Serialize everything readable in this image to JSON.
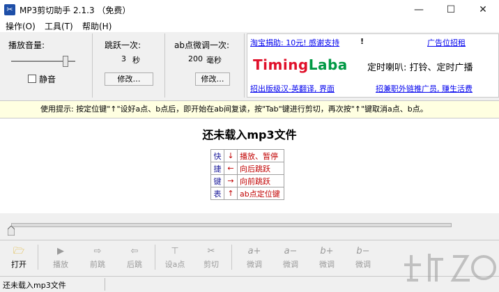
{
  "window": {
    "title": "MP3剪切助手 2.1.3 （免费）",
    "minimize": "—",
    "maximize": "☐",
    "close": "✕"
  },
  "menu": {
    "items": [
      "操作(O)",
      "工具(T)",
      "帮助(H)"
    ]
  },
  "volume_panel": {
    "label": "播放音量:",
    "level": 0.85,
    "mute_label": "静音",
    "mute_checked": false
  },
  "jump_panel": {
    "label": "跳跃一次:",
    "value": "3",
    "unit": "秒",
    "button": "修改…"
  },
  "ab_panel": {
    "label": "ab点微调一次:",
    "value": "200",
    "unit": "毫秒",
    "button": "修改…"
  },
  "ad_panel": {
    "donate_link": "淘宝捐助: 10元! 感谢支持",
    "donate_suffix": "!",
    "ad_link": "广告位招租",
    "logo_text": "TimingLaba",
    "logo_slogan": "定时喇叭: 打铃、定时广播",
    "bottom_left_link": "招出版级汉-英翻译, 界面",
    "bottom_right_link": "招兼职外链推广员, 赚生活费"
  },
  "tip": "使用提示: 按定位键\"↑\"设好a点、b点后，即开始在ab间复读，按\"Tab\"键进行剪切，再次按\"↑\"键取消a点、b点。",
  "main": {
    "title": "还未载入mp3文件",
    "shortcut_chars": [
      "快",
      "捷",
      "键",
      "表"
    ],
    "shortcuts": [
      {
        "key": "↓",
        "desc": "播放、暂停"
      },
      {
        "key": "←",
        "desc": "向后跳跃"
      },
      {
        "key": "→",
        "desc": "向前跳跃"
      },
      {
        "key": "↑",
        "desc": "ab点定位键"
      }
    ]
  },
  "progress": {
    "value": 0
  },
  "toolbar": {
    "open": "打开",
    "play": "播放",
    "forward": "前跳",
    "back": "后跳",
    "set_a": "设a点",
    "cut": "剪切",
    "a_plus": "微调",
    "a_minus": "微调",
    "b_plus": "微调",
    "b_minus": "微调",
    "a_plus_icon": "a+",
    "a_minus_icon": "a−",
    "b_plus_icon": "b+",
    "b_minus_icon": "b−"
  },
  "status": {
    "text": "还未载入mp3文件"
  },
  "colors": {
    "tip_background": "#ffffe1",
    "shortcut_red": "#c00000",
    "shortcut_blue": "#1a1a9a",
    "logo_red": "#e0102a",
    "logo_green": "#009944"
  }
}
